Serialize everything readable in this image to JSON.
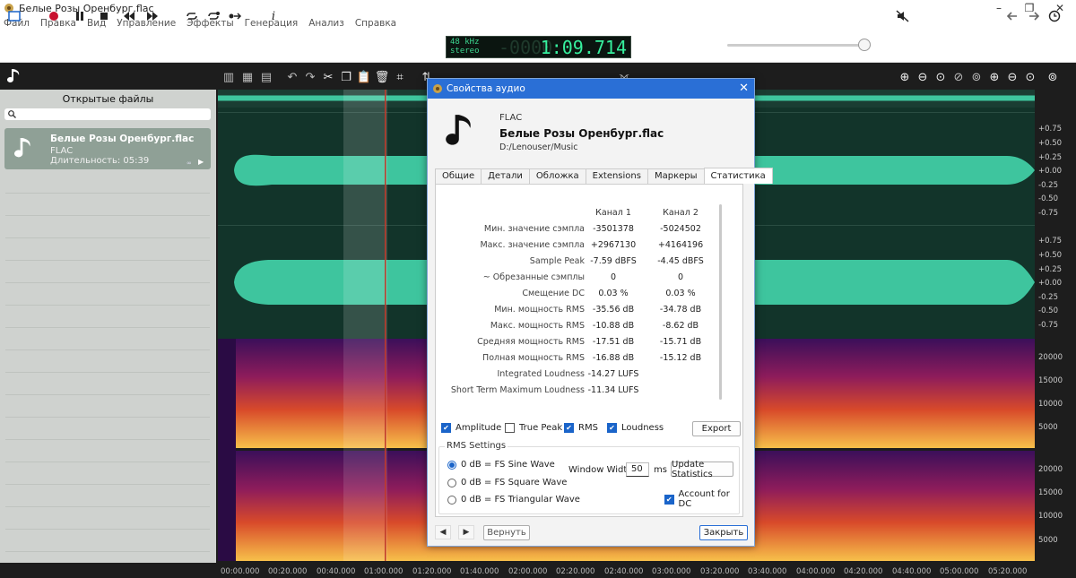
{
  "window": {
    "title": "Белые Розы Оренбург.flac",
    "minimize": "–",
    "maximize": "❐",
    "close": "✕"
  },
  "menu": [
    "Файл",
    "Правка",
    "Вид",
    "Управление",
    "Эффекты",
    "Генерация",
    "Анализ",
    "Справка"
  ],
  "lcd": {
    "rate": "48 kHz",
    "channels": "stereo",
    "ghost": "-0000",
    "time": "1:09.714"
  },
  "volume": {
    "level": 0.92
  },
  "sidebar": {
    "title": "Открытые файлы",
    "search_placeholder": "",
    "file": {
      "name": "Белые Розы Оренбург.flac",
      "format": "FLAC",
      "duration": "Длительность: 05:39"
    }
  },
  "scale": {
    "amplitude": [
      "+0.75",
      "+0.50",
      "+0.25",
      "+0.00",
      "-0.25",
      "-0.50",
      "-0.75",
      "+0.75",
      "+0.50",
      "+0.25",
      "+0.00",
      "-0.25",
      "-0.50",
      "-0.75"
    ],
    "frequency": [
      "20000",
      "15000",
      "10000",
      "5000",
      "20000",
      "15000",
      "10000",
      "5000"
    ]
  },
  "timeline": [
    "00:00.000",
    "00:20.000",
    "00:40.000",
    "01:00.000",
    "01:20.000",
    "01:40.000",
    "02:00.000",
    "02:20.000",
    "02:40.000",
    "03:00.000",
    "03:20.000",
    "03:40.000",
    "04:00.000",
    "04:20.000",
    "04:40.000",
    "05:00.000",
    "05:20.000"
  ],
  "dialog": {
    "title": "Свойства аудио",
    "close": "✕",
    "format": "FLAC",
    "filename": "Белые Розы Оренбург.flac",
    "path": "D:/Lenouser/Music",
    "tabs": [
      "Общие",
      "Детали",
      "Обложка",
      "Extensions",
      "Маркеры",
      "Статистика"
    ],
    "columns": [
      "Канал 1",
      "Канал 2"
    ],
    "stats": [
      {
        "label": "Мин. значение сэмпла",
        "c1": "-3501378",
        "c2": "-5024502"
      },
      {
        "label": "Макс. значение сэмпла",
        "c1": "+2967130",
        "c2": "+4164196"
      },
      {
        "label": "Sample Peak",
        "c1": "-7.59 dBFS",
        "c2": "-4.45 dBFS"
      },
      {
        "label": "~ Обрезанные сэмплы",
        "c1": "0",
        "c2": "0"
      },
      {
        "label": "Смещение DC",
        "c1": "0.03 %",
        "c2": "0.03 %"
      },
      {
        "label": "Мин. мощность RMS",
        "c1": "-35.56 dB",
        "c2": "-34.78 dB"
      },
      {
        "label": "Макс. мощность RMS",
        "c1": "-10.88 dB",
        "c2": "-8.62 dB"
      },
      {
        "label": "Средняя мощность RMS",
        "c1": "-17.51 dB",
        "c2": "-15.71 dB"
      },
      {
        "label": "Полная мощность RMS",
        "c1": "-16.88 dB",
        "c2": "-15.12 dB"
      },
      {
        "label": "Integrated Loudness",
        "c1": "-14.27 LUFS",
        "c2": ""
      },
      {
        "label": "Short Term Maximum Loudness",
        "c1": "-11.34 LUFS",
        "c2": ""
      }
    ],
    "checks": {
      "amplitude": "Amplitude",
      "true_peak": "True Peak",
      "rms": "RMS",
      "loudness": "Loudness"
    },
    "export": "Export",
    "rms_settings": {
      "title": "RMS Settings",
      "sine": "0 dB = FS Sine Wave",
      "square": "0 dB = FS Square Wave",
      "triangular": "0 dB = FS Triangular Wave",
      "window_label": "Window Width",
      "window_value": "50",
      "unit": "ms",
      "update": "Update Statistics",
      "dc": "Account for DC"
    },
    "nav_prev": "◀",
    "nav_next": "▶",
    "revert": "Вернуть",
    "close_btn": "Закрыть"
  },
  "colors": {
    "accent": "#2a6fd6",
    "wave": "#3ec59e",
    "wave_bg": "#12342a"
  }
}
